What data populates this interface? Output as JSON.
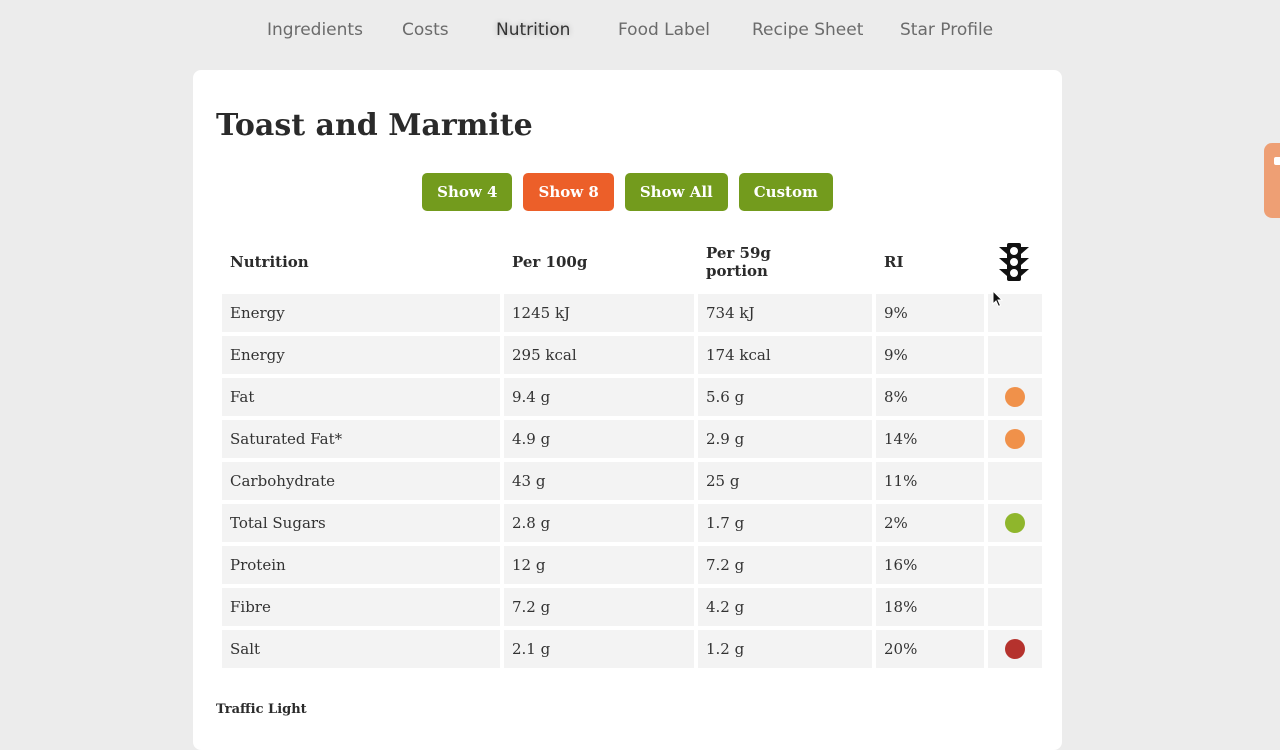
{
  "nav": {
    "tabs": [
      "Ingredients",
      "Costs",
      "Nutrition",
      "Food Label",
      "Recipe Sheet",
      "Star Profile"
    ],
    "active": "Nutrition"
  },
  "recipe": {
    "title": "Toast and Marmite"
  },
  "buttons": {
    "show4": "Show 4",
    "show8": "Show 8",
    "show_all": "Show All",
    "custom": "Custom"
  },
  "table": {
    "headers": [
      "Nutrition",
      "Per 100g",
      "Per 59g portion",
      "RI"
    ],
    "header_portion_line1": "Per 59g",
    "header_portion_line2": "portion",
    "traffic_light_icon": "traffic-light-icon",
    "rows": [
      {
        "name": "Energy",
        "per100": "1245 kJ",
        "portion": "734 kJ",
        "ri": "9%",
        "light": ""
      },
      {
        "name": "Energy",
        "per100": "295 kcal",
        "portion": "174 kcal",
        "ri": "9%",
        "light": ""
      },
      {
        "name": "Fat",
        "per100": "9.4 g",
        "portion": "5.6 g",
        "ri": "8%",
        "light": "#f0914a"
      },
      {
        "name": "Saturated Fat*",
        "per100": "4.9 g",
        "portion": "2.9 g",
        "ri": "14%",
        "light": "#f0914a"
      },
      {
        "name": "Carbohydrate",
        "per100": "43 g",
        "portion": "25 g",
        "ri": "11%",
        "light": ""
      },
      {
        "name": "Total Sugars",
        "per100": "2.8 g",
        "portion": "1.7 g",
        "ri": "2%",
        "light": "#8fb62c"
      },
      {
        "name": "Protein",
        "per100": "12 g",
        "portion": "7.2 g",
        "ri": "16%",
        "light": ""
      },
      {
        "name": "Fibre",
        "per100": "7.2 g",
        "portion": "4.2 g",
        "ri": "18%",
        "light": ""
      },
      {
        "name": "Salt",
        "per100": "2.1 g",
        "portion": "1.2 g",
        "ri": "20%",
        "light": "#b5322d"
      }
    ]
  },
  "footer": {
    "label": "Traffic Light"
  },
  "colors": {
    "green": "#739b1d",
    "orange": "#ec5f29",
    "amber": "#f0914a",
    "red": "#b5322d",
    "lightgreen": "#8fb62c"
  }
}
